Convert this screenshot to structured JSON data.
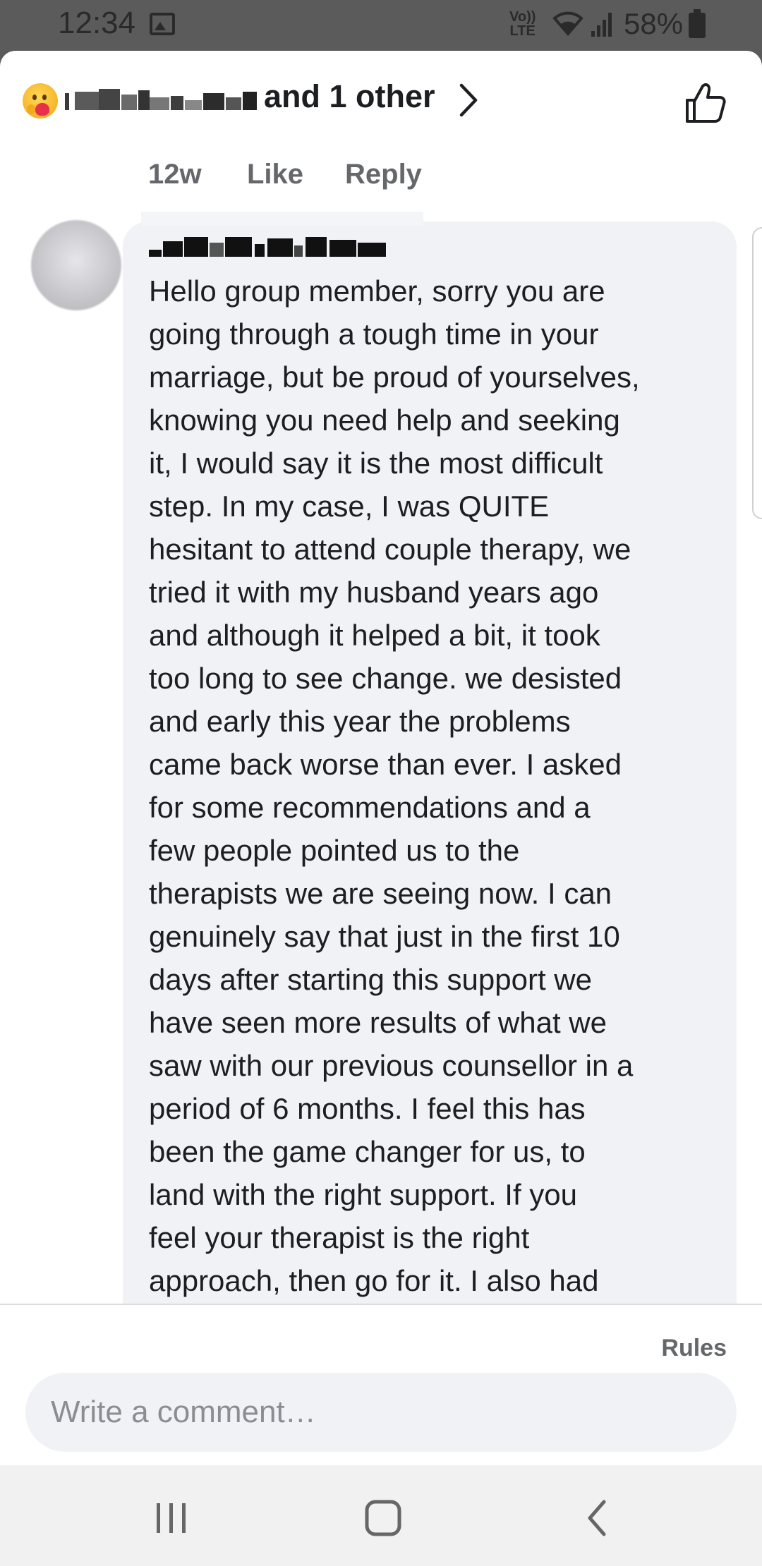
{
  "status_bar": {
    "time": "12:34",
    "volte_line1": "Vo))",
    "volte_line2": "LTE",
    "battery": "58%"
  },
  "reactions": {
    "emoji": "care-reaction-icon",
    "text": "and 1 other"
  },
  "comment_actions": {
    "age": "12w",
    "like": "Like",
    "reply": "Reply"
  },
  "comment": {
    "body": "Hello group member, sorry you are\ngoing through a tough time in your\nmarriage, but be proud of yourselves,\nknowing you need help and seeking\nit, I would say it is the most difficult\nstep. In my case, I was QUITE\nhesitant to attend couple therapy, we\ntried it with my husband years ago\nand although it helped a bit, it took\ntoo long to see change. we desisted\nand early this year the problems\ncame back worse than ever. I asked\nfor some recommendations and a\nfew people pointed us to the\ntherapists we are seeing now. I can\ngenuinely say that just in the first 10\ndays after starting this support we\nhave seen more results of what we\nsaw with our previous counsellor in a\nperiod of 6 months. I feel this has\nbeen the game changer for us, to\nland with the right support.  If you\nfeel your therapist is the right\napproach, then go for it. I also had"
  },
  "composer": {
    "rules": "Rules",
    "placeholder": "Write a comment…"
  },
  "colors": {
    "bubble": "#f0f2f5",
    "secondary_text": "#65676b",
    "primary_text": "#1c1e21"
  }
}
